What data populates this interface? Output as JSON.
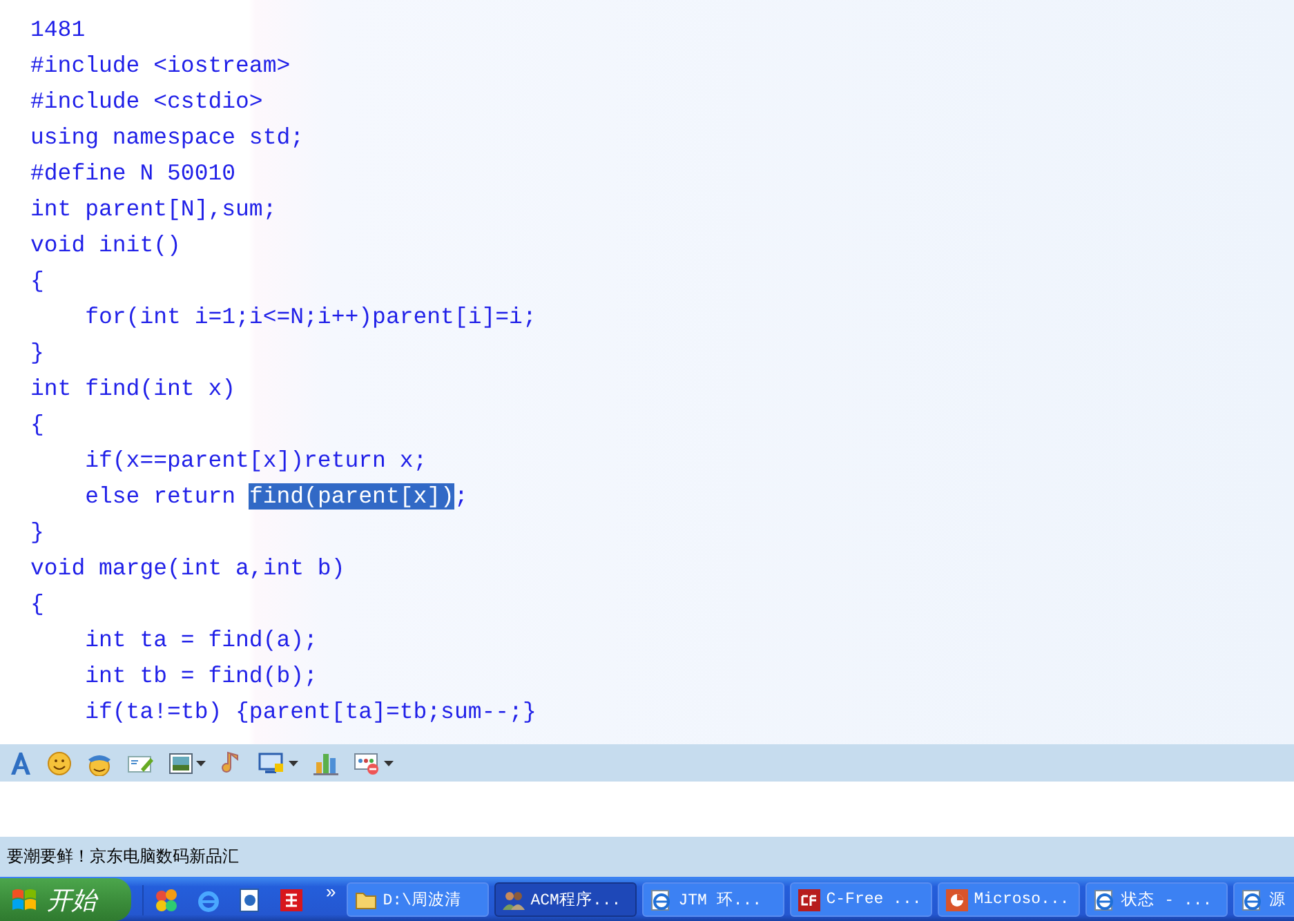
{
  "message": {
    "lines": [
      {
        "segments": [
          {
            "text": "1481",
            "selected": false
          }
        ]
      },
      {
        "segments": [
          {
            "text": "#include <iostream>",
            "selected": false
          }
        ]
      },
      {
        "segments": [
          {
            "text": "#include <cstdio>",
            "selected": false
          }
        ]
      },
      {
        "segments": [
          {
            "text": "using namespace std;",
            "selected": false
          }
        ]
      },
      {
        "segments": [
          {
            "text": "#define N 50010",
            "selected": false
          }
        ]
      },
      {
        "segments": [
          {
            "text": "int parent[N],sum;",
            "selected": false
          }
        ]
      },
      {
        "segments": [
          {
            "text": "void init()",
            "selected": false
          }
        ]
      },
      {
        "segments": [
          {
            "text": "{",
            "selected": false
          }
        ]
      },
      {
        "segments": [
          {
            "text": "    for(int i=1;i<=N;i++)parent[i]=i;",
            "selected": false
          }
        ]
      },
      {
        "segments": [
          {
            "text": "}",
            "selected": false
          }
        ]
      },
      {
        "segments": [
          {
            "text": "int find(int x)",
            "selected": false
          }
        ]
      },
      {
        "segments": [
          {
            "text": "{",
            "selected": false
          }
        ]
      },
      {
        "segments": [
          {
            "text": "    if(x==parent[x])return x;",
            "selected": false
          }
        ]
      },
      {
        "segments": [
          {
            "text": "    else return ",
            "selected": false
          },
          {
            "text": "find(parent[x])",
            "selected": true
          },
          {
            "text": ";",
            "selected": false
          }
        ]
      },
      {
        "segments": [
          {
            "text": "}",
            "selected": false
          }
        ]
      },
      {
        "segments": [
          {
            "text": "void marge(int a,int b)",
            "selected": false
          }
        ]
      },
      {
        "segments": [
          {
            "text": "{",
            "selected": false
          }
        ]
      },
      {
        "segments": [
          {
            "text": "    int ta = find(a);",
            "selected": false
          }
        ]
      },
      {
        "segments": [
          {
            "text": "    int tb = find(b);",
            "selected": false
          }
        ]
      },
      {
        "segments": [
          {
            "text": "    if(ta!=tb) {parent[ta]=tb;sum--;}",
            "selected": false
          }
        ]
      }
    ]
  },
  "toolbar": [
    {
      "kind": "font",
      "caret": false
    },
    {
      "kind": "smiley",
      "caret": false
    },
    {
      "kind": "hat",
      "caret": false
    },
    {
      "kind": "card",
      "caret": false
    },
    {
      "kind": "picture",
      "caret": true
    },
    {
      "kind": "note",
      "caret": false
    },
    {
      "kind": "screen",
      "caret": true
    },
    {
      "kind": "chart",
      "caret": false
    },
    {
      "kind": "apps",
      "caret": true
    }
  ],
  "ad": {
    "text": "要潮要鲜！京东电脑数码新品汇"
  },
  "taskbar": {
    "start": "开始",
    "quick_launch": [
      {
        "kind": "balls"
      },
      {
        "kind": "ie"
      },
      {
        "kind": "doc"
      },
      {
        "kind": "red"
      }
    ],
    "more": "»",
    "tasks": [
      {
        "label": "D:\\周波清",
        "kind": "folder",
        "selected": false
      },
      {
        "label": "ACM程序...",
        "kind": "people",
        "selected": true
      },
      {
        "label": "JTM 环...",
        "kind": "ie",
        "selected": false
      },
      {
        "label": "C-Free ...",
        "kind": "cf",
        "selected": false
      },
      {
        "label": "Microso...",
        "kind": "ppt",
        "selected": false
      },
      {
        "label": "状态 - ...",
        "kind": "ie",
        "selected": false
      },
      {
        "label": "源",
        "kind": "ie",
        "selected": false
      }
    ]
  }
}
